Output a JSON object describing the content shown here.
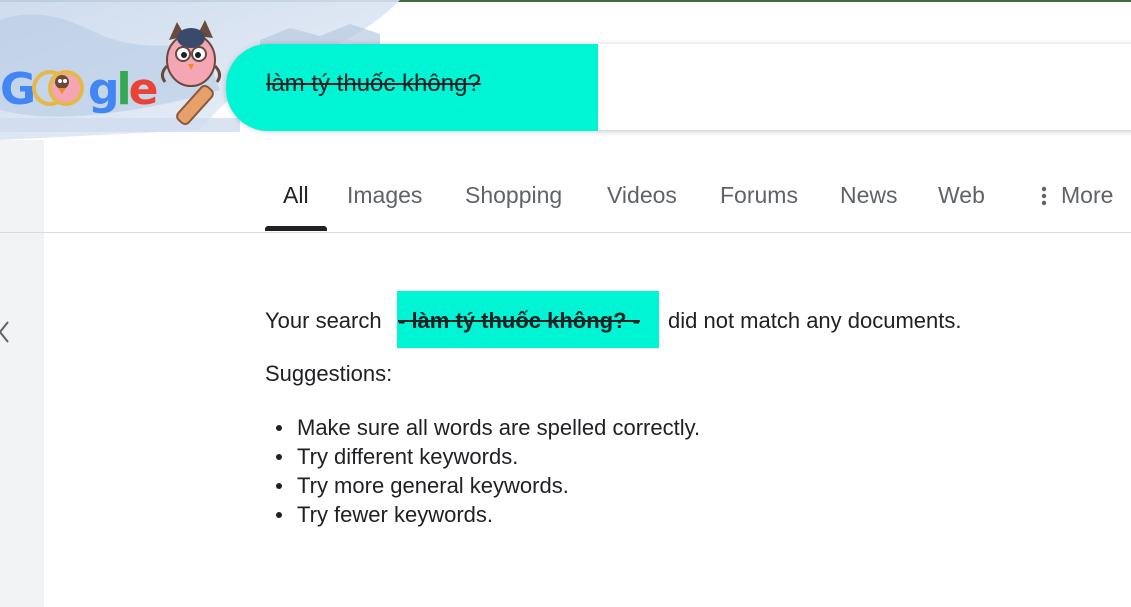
{
  "search": {
    "query": "làm tý thuốc không?",
    "highlight_color": "#00f5d4"
  },
  "logo": {
    "text": "Google",
    "icon": "google-doodle-owl"
  },
  "tabs": [
    {
      "label": "All",
      "active": true
    },
    {
      "label": "Images",
      "active": false
    },
    {
      "label": "Shopping",
      "active": false
    },
    {
      "label": "Videos",
      "active": false
    },
    {
      "label": "Forums",
      "active": false
    },
    {
      "label": "News",
      "active": false
    },
    {
      "label": "Web",
      "active": false
    },
    {
      "label": "More",
      "active": false,
      "icon": "vertical-dots-icon"
    }
  ],
  "results": {
    "message_prefix": "Your search",
    "message_query": "- làm tý thuốc không? -",
    "message_suffix": "did not match any documents.",
    "suggestions_title": "Suggestions:",
    "suggestions": [
      "Make sure all words are spelled correctly.",
      "Try different keywords.",
      "Try more general keywords.",
      "Try fewer keywords."
    ]
  },
  "icons": {
    "back": "chevron-left-icon"
  }
}
